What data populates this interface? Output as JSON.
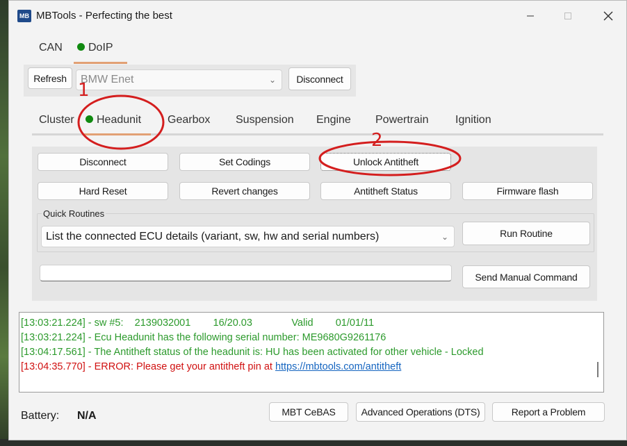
{
  "window": {
    "app_icon_text": "MB",
    "title": "MBTools - Perfecting the best"
  },
  "protocol_tabs": [
    {
      "label": "CAN",
      "active": false
    },
    {
      "label": "DoIP",
      "active": true,
      "status_color": "#108a10"
    }
  ],
  "connection": {
    "refresh_label": "Refresh",
    "interface_value": "BMW Enet",
    "disconnect_label": "Disconnect"
  },
  "module_tabs": [
    {
      "label": "Cluster"
    },
    {
      "label": "Headunit",
      "active": true,
      "status_color": "#108a10"
    },
    {
      "label": "Gearbox"
    },
    {
      "label": "Suspension"
    },
    {
      "label": "Engine"
    },
    {
      "label": "Powertrain"
    },
    {
      "label": "Ignition"
    }
  ],
  "actions": {
    "disconnect": "Disconnect",
    "set_codings": "Set Codings",
    "unlock_antitheft": "Unlock Antitheft",
    "hard_reset": "Hard Reset",
    "revert_changes": "Revert changes",
    "antitheft_status": "Antitheft Status",
    "firmware_flash": "Firmware flash"
  },
  "quick_routines": {
    "group_label": "Quick Routines",
    "selected": "List the connected ECU details (variant, sw, hw and serial numbers)",
    "run_label": "Run Routine"
  },
  "manual_command": {
    "value": "",
    "send_label": "Send Manual Command"
  },
  "log": [
    {
      "text": "[13:03:21.224] - sw #5:    2139032001        16/20.03              Valid        01/01/11",
      "level": "ok"
    },
    {
      "text": "[13:03:21.224] - Ecu Headunit has the following serial number: ME9680G9261176",
      "level": "ok"
    },
    {
      "text": "[13:04:17.561] - The Antitheft status of the headunit is: HU has been activated for other vehicle - Locked",
      "level": "ok"
    },
    {
      "text": "[13:04:35.770] - ERROR: Please get your antitheft pin at ",
      "link": "https://mbtools.com/antitheft",
      "level": "err"
    }
  ],
  "footer": {
    "battery_label": "Battery:",
    "battery_value": "N/A",
    "mbt_cebas": "MBT CeBAS",
    "advanced_ops": "Advanced Operations (DTS)",
    "report_problem": "Report a Problem"
  },
  "annotations": {
    "num1": "1",
    "num2": "2",
    "color": "#d41e1e"
  }
}
